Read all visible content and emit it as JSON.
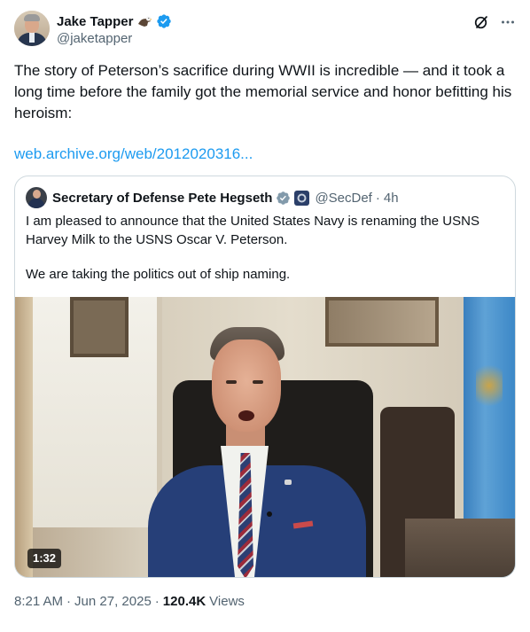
{
  "author": {
    "display_name": "Jake Tapper",
    "handle": "@jaketapper",
    "badge_icons": [
      "bald-eagle-emoji",
      "verified-blue-icon"
    ]
  },
  "actions": {
    "grok_icon": "grok-icon",
    "more_icon": "more-dots-icon",
    "more_label": "···"
  },
  "tweet": {
    "text": "The story of  Peterson’s sacrifice during WWII is incredible — and it took a long time before the family got the memorial service and honor befitting his heroism:",
    "link": "web.archive.org/web/2012020316..."
  },
  "quote": {
    "display_name": "Secretary of Defense Pete Hegseth",
    "handle": "@SecDef",
    "time_ago": "4h",
    "separator": "·",
    "badge_icons": [
      "verified-gray-icon",
      "dod-affiliate-badge"
    ],
    "paragraphs": [
      "I am pleased to announce that the United States Navy is renaming the USNS Harvey Milk to the USNS Oscar V. Peterson.",
      "We are taking the politics out of ship naming."
    ],
    "video": {
      "duration": "1:32"
    }
  },
  "meta": {
    "time": "8:21 AM",
    "date": "Jun 27, 2025",
    "separator": "·",
    "views_count": "120.4K",
    "views_label": "Views"
  },
  "colors": {
    "text_primary": "#0f1419",
    "text_secondary": "#536471",
    "link": "#1d9bf0",
    "border": "#cfd9de",
    "verified_blue": "#1d9bf0",
    "verified_gray": "#829aab"
  }
}
